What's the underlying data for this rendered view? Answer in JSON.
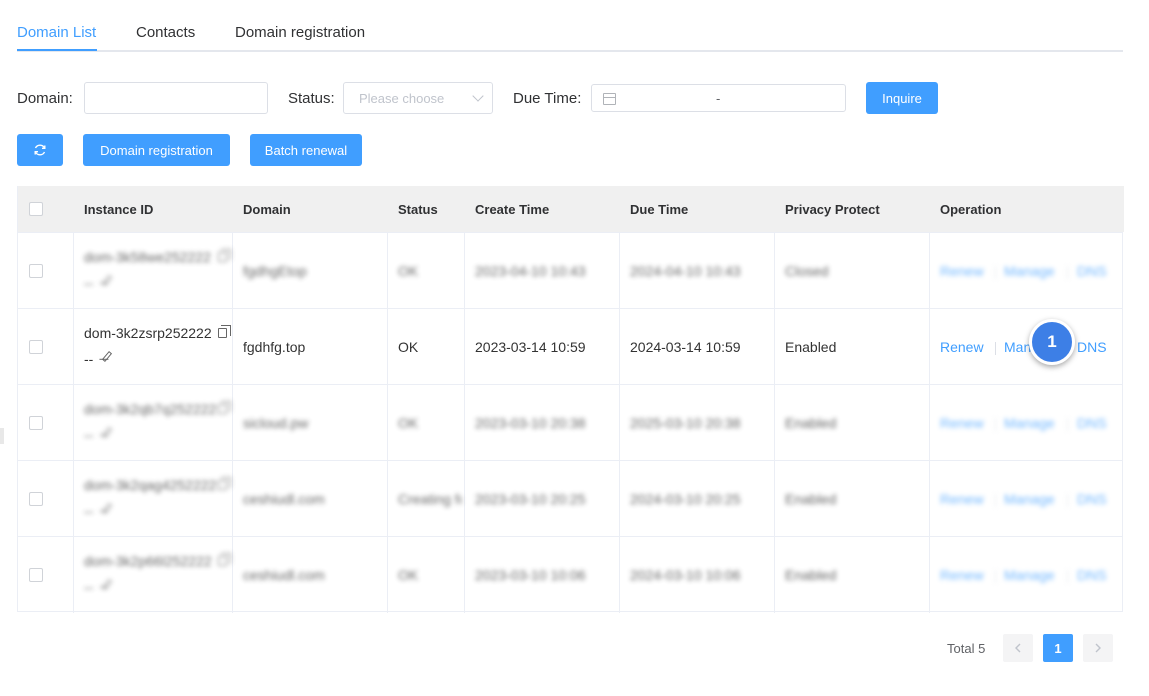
{
  "tabs": [
    {
      "label": "Domain List",
      "active": true
    },
    {
      "label": "Contacts",
      "active": false
    },
    {
      "label": "Domain registration",
      "active": false
    }
  ],
  "filters": {
    "domain_label": "Domain:",
    "domain_value": "",
    "status_label": "Status:",
    "status_placeholder": "Please choose",
    "due_time_label": "Due Time:",
    "due_time_separator": "-",
    "inquire_label": "Inquire"
  },
  "toolbar": {
    "refresh_icon": "refresh-icon",
    "register_label": "Domain registration",
    "batch_renew_label": "Batch renewal"
  },
  "table": {
    "columns": [
      "Instance ID",
      "Domain",
      "Status",
      "Create Time",
      "Due Time",
      "Privacy Protect",
      "Operation"
    ],
    "rows": [
      {
        "instance_id": "dom-3k58we252222",
        "remark": "--",
        "domain": "fgdhgEtop",
        "status": "OK",
        "create_time": "2023-04-10 10:43",
        "due_time": "2024-04-10 10:43",
        "privacy": "Closed",
        "ops": [
          "Renew",
          "Manage",
          "DNS"
        ],
        "blurred": true
      },
      {
        "instance_id": "dom-3k2zsrp252222",
        "remark": "--",
        "domain": "fgdhfg.top",
        "status": "OK",
        "create_time": "2023-03-14 10:59",
        "due_time": "2024-03-14 10:59",
        "privacy": "Enabled",
        "ops": [
          "Renew",
          "Manage",
          "DNS"
        ],
        "blurred": false
      },
      {
        "instance_id": "dom-3k2qb7q252222",
        "remark": "--",
        "domain": "sicloud.pw",
        "status": "OK",
        "create_time": "2023-03-10 20:38",
        "due_time": "2025-03-10 20:38",
        "privacy": "Enabled",
        "ops": [
          "Renew",
          "Manage",
          "DNS"
        ],
        "blurred": true
      },
      {
        "instance_id": "dom-3k2qag4252222",
        "remark": "--",
        "domain": "ceshiudl.com",
        "status": "Creating fc",
        "create_time": "2023-03-10 20:25",
        "due_time": "2024-03-10 20:25",
        "privacy": "Enabled",
        "ops": [
          "Renew",
          "Manage",
          "DNS"
        ],
        "blurred": true
      },
      {
        "instance_id": "dom-3k2p66l252222",
        "remark": "--",
        "domain": "ceshiudl.com",
        "status": "OK",
        "create_time": "2023-03-10 10:06",
        "due_time": "2024-03-10 10:06",
        "privacy": "Enabled",
        "ops": [
          "Renew",
          "Manage",
          "DNS"
        ],
        "blurred": true
      }
    ]
  },
  "marker": {
    "label": "1"
  },
  "pagination": {
    "total_text": "Total 5",
    "current": "1",
    "prev_icon": "chevron-left-icon",
    "next_icon": "chevron-right-icon"
  },
  "colors": {
    "accent": "#409eff",
    "marker": "#3d7fe6"
  }
}
